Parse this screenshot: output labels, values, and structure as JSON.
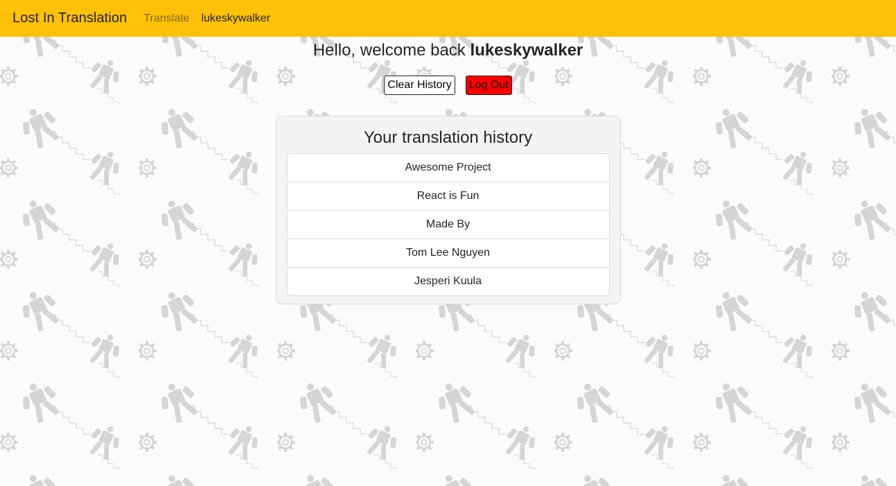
{
  "navbar": {
    "brand": "Lost In Translation",
    "links": [
      {
        "label": "Translate"
      },
      {
        "label": "lukeskywalker"
      }
    ],
    "background_color": "#ffc107"
  },
  "greeting": {
    "prefix": "Hello, welcome back",
    "username": "lukeskywalker"
  },
  "actions": {
    "clear_label": "Clear History",
    "logout_label": "Log Out",
    "logout_color": "#ff0000"
  },
  "history": {
    "title": "Your translation history",
    "items": [
      "Awesome Project",
      "React is Fun",
      "Made By",
      "Tom Lee Nguyen",
      "Jesperi Kuula"
    ]
  },
  "background": {
    "pattern_icons": [
      "robot-icon",
      "gear-icon"
    ]
  }
}
